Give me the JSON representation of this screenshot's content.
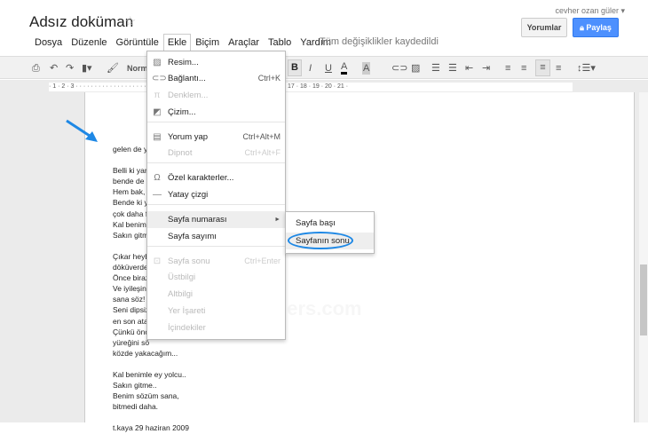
{
  "header": {
    "title": "Adsız doküman",
    "user": "cevher ozan güler ▾",
    "comments_button": "Yorumlar",
    "share_button": "Paylaş",
    "saved_status": "Tüm değişiklikler kaydedildi"
  },
  "menubar": [
    "Dosya",
    "Düzenle",
    "Görüntüle",
    "Ekle",
    "Biçim",
    "Araçlar",
    "Tablo",
    "Yardım"
  ],
  "toolbar": {
    "style": "Norm",
    "bold": "B",
    "italic": "I",
    "underline": "U",
    "text_color": "A",
    "highlight": "A"
  },
  "ruler": "· 1 · 2 · 3 ·  ·  ·  ·  ·  ·  ·  ·  ·  ·  ·  ·  ·  ·  ·  ·  ·  ·  ·  ·  ·  ·  ·  ·  ·  ·  ·  ·  ·  ·  ·  · · 10 · 11 · 12 · 13 · 14 · 15 · 16 · 17 · 18 · 19 · 20 · 21 ·",
  "insert_menu": [
    {
      "label": "Resim...",
      "icon": "image-icon",
      "shortcut": "",
      "disabled": false
    },
    {
      "label": "Bağlantı...",
      "icon": "link-icon",
      "shortcut": "Ctrl+K",
      "disabled": false
    },
    {
      "label": "Denklem...",
      "icon": "pi-icon",
      "shortcut": "",
      "disabled": true
    },
    {
      "label": "Çizim...",
      "icon": "drawing-icon",
      "shortcut": "",
      "disabled": false
    },
    {
      "label": "Yorum yap",
      "icon": "comment-icon",
      "shortcut": "Ctrl+Alt+M",
      "disabled": false
    },
    {
      "label": "Dipnot",
      "icon": "",
      "shortcut": "Ctrl+Alt+F",
      "disabled": true
    },
    {
      "label": "Özel karakterler...",
      "icon": "omega-icon",
      "shortcut": "",
      "disabled": false
    },
    {
      "label": "Yatay çizgi",
      "icon": "horizontal-line-icon",
      "shortcut": "",
      "disabled": false
    },
    {
      "label": "Sayfa numarası",
      "icon": "",
      "shortcut": "►",
      "disabled": false
    },
    {
      "label": "Sayfa sayımı",
      "icon": "",
      "shortcut": "",
      "disabled": false
    },
    {
      "label": "Sayfa sonu",
      "icon": "page-break-icon",
      "shortcut": "Ctrl+Enter",
      "disabled": true
    },
    {
      "label": "Üstbilgi",
      "icon": "",
      "shortcut": "",
      "disabled": true
    },
    {
      "label": "Altbilgi",
      "icon": "",
      "shortcut": "",
      "disabled": true
    },
    {
      "label": "Yer İşareti",
      "icon": "",
      "shortcut": "",
      "disabled": true
    },
    {
      "label": "İçindekiler",
      "icon": "",
      "shortcut": "",
      "disabled": true
    }
  ],
  "page_number_submenu": [
    "Sayfa başı",
    "Sayfanın sonu"
  ],
  "document_lines": [
    "gelen de yo",
    "",
    "Belli ki yara",
    "bende de v",
    "Hem bak, ",
    "Bende ki y",
    "çok daha fe",
    "Kal benimle",
    "Sakın gitme",
    "",
    "Çıkar heyb",
    "döküverde",
    "Önce biraz",
    "Ve iyileşinc",
    "sana söz!",
    "Seni dipsiz",
    "en son ata",
    "Çünkü önc",
    "yüreğini sö",
    "közde yakacağım...",
    "",
    "Kal benimle ey yolcu..",
    "Sakın gitme..",
    "Benim sözüm sana,",
    "bitmedi daha.",
    "",
    "t.kaya 29 haziran 2009"
  ],
  "watermark": "digitalders.com",
  "colors": {
    "accent": "#4d90fe",
    "annotation": "#1e88e5"
  }
}
